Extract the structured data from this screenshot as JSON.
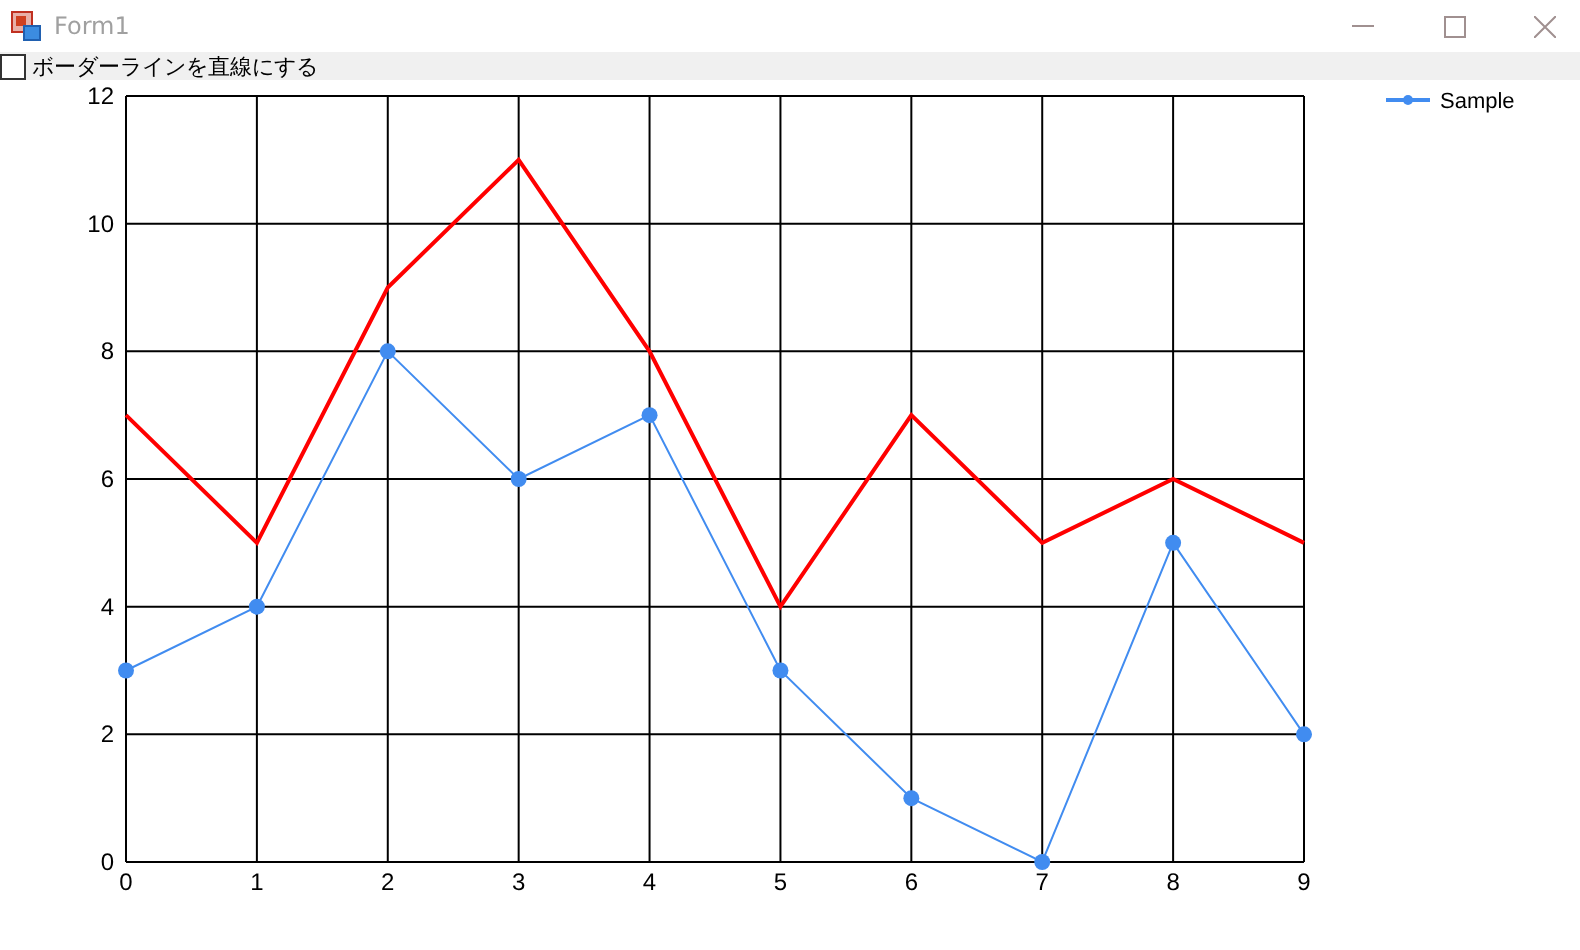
{
  "window": {
    "title": "Form1"
  },
  "checkbox": {
    "label": "ボーダーラインを直線にする",
    "checked": false
  },
  "chart_data": {
    "type": "line",
    "categories": [
      "0",
      "1",
      "2",
      "3",
      "4",
      "5",
      "6",
      "7",
      "8",
      "9"
    ],
    "ylim": [
      0,
      12
    ],
    "yticks": [
      0,
      2,
      4,
      6,
      8,
      10,
      12
    ],
    "grid": true,
    "series": [
      {
        "name": "Sample",
        "color": "#418cf0",
        "marker": "circle",
        "values": [
          3,
          4,
          8,
          6,
          7,
          3,
          1,
          0,
          5,
          2
        ]
      },
      {
        "color": "#ff0000",
        "values": [
          7,
          5,
          9,
          11,
          8,
          4,
          7,
          5,
          6,
          5
        ]
      }
    ]
  }
}
